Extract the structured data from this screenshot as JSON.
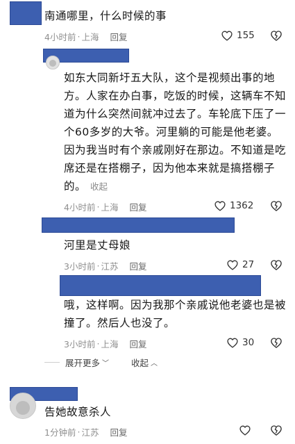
{
  "comments": [
    {
      "text": "南通哪里，什么时候的事",
      "time": "4小时前",
      "location": "上海",
      "reply_label": "回复",
      "likes": "155"
    },
    {
      "text": "如东大同新圩五大队，这个是视频出事的地方。人家在办白事，吃饭的时候，这辆车不知道为什么突然间就冲过去了。车轮底下压了一个60多岁的大爷。河里躺的可能是他老婆。因为我当时有个亲戚刚好在那边。不知道是吃席还是在搭棚子，因为他本来就是搞搭棚子的。",
      "collapse_label": "收起",
      "time": "4小时前",
      "location": "上海",
      "reply_label": "回复",
      "likes": "1362"
    },
    {
      "text": "河里是丈母娘",
      "time": "3小时前",
      "location": "江苏",
      "reply_label": "回复",
      "likes": "27"
    },
    {
      "text": "哦，这样啊。因为我那个亲戚说他老婆也是被撞了。然后人也没了。",
      "time": "3小时前",
      "location": "上海",
      "reply_label": "回复",
      "likes": "30"
    },
    {
      "text": "告她故意杀人",
      "time": "1分钟前",
      "location": "江苏",
      "reply_label": "回复",
      "likes": ""
    }
  ],
  "thread": {
    "expand_more_label": "展开更多",
    "collapse_label": "收起"
  },
  "icons": {
    "like": "heart-outline-icon",
    "dislike": "broken-heart-icon",
    "expand": "chevron-down-icon",
    "collapse": "chevron-up-icon"
  },
  "colors": {
    "redaction": "#3d5fb0",
    "meta": "#8f8f8f",
    "text": "#161616"
  }
}
